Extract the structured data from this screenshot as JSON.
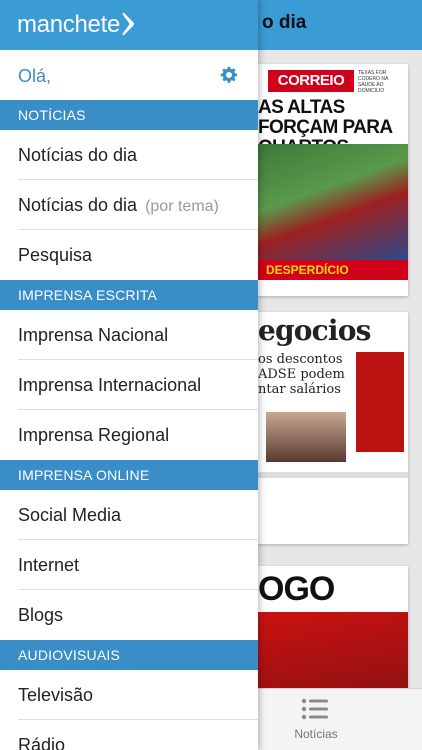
{
  "app": {
    "brand": "manchete",
    "background_title": "o dia"
  },
  "drawer": {
    "greeting": "Olá,",
    "sections": [
      {
        "title": "NOTÍCIAS",
        "items": [
          {
            "label": "Notícias do dia"
          },
          {
            "label": "Notícias do dia",
            "sub": "(por tema)"
          },
          {
            "label": "Pesquisa"
          }
        ]
      },
      {
        "title": "IMPRENSA ESCRITA",
        "items": [
          {
            "label": "Imprensa Nacional"
          },
          {
            "label": "Imprensa Internacional"
          },
          {
            "label": "Imprensa Regional"
          }
        ]
      },
      {
        "title": "IMPRENSA ONLINE",
        "items": [
          {
            "label": "Social Media"
          },
          {
            "label": "Internet"
          },
          {
            "label": "Blogs"
          }
        ]
      },
      {
        "title": "AUDIOVISUAIS",
        "items": [
          {
            "label": "Televisão"
          },
          {
            "label": "Rádio"
          }
        ]
      }
    ]
  },
  "covers": [
    {
      "masthead": "CORREIO",
      "side_text": "TEXAS FOR CODERO NA SAUDE AO DOMICILIO",
      "headline": "AS ALTAS FORÇAM PARA QUARTOS",
      "strip": "DESPERDÍCIO"
    },
    {
      "masthead": "egocios",
      "body": "os descontos ADSE podem ntar salários"
    },
    {
      "masthead": "OGO"
    }
  ],
  "tabbar": {
    "label": "Notícias"
  },
  "colors": {
    "brand_blue": "#3a9bd5",
    "section_blue": "#3a8ec8"
  },
  "icons": {
    "settings": "gear-icon",
    "logo": "manchete-chevron-icon",
    "tab": "list-icon"
  }
}
